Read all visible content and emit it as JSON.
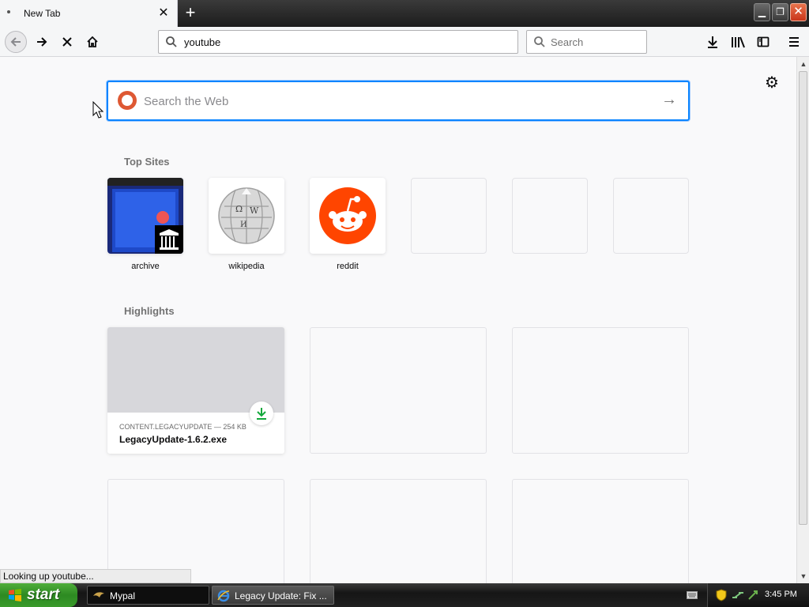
{
  "browser": {
    "tab": {
      "title": "New Tab",
      "close_glyph": "✕"
    },
    "newtab_glyph": "+",
    "window_controls": {
      "minimize": "▁",
      "restore": "❐",
      "close": "✕"
    },
    "url": "youtube",
    "search_placeholder": "Search"
  },
  "newtab": {
    "web_search_placeholder": "Search the Web",
    "top_sites_title": "Top Sites",
    "top_sites": [
      {
        "label": "archive"
      },
      {
        "label": "wikipedia"
      },
      {
        "label": "reddit"
      }
    ],
    "highlights_title": "Highlights",
    "highlight": {
      "source": "CONTENT.LEGACYUPDATE — 254 KB",
      "title": "LegacyUpdate-1.6.2.exe"
    }
  },
  "status_text": "Looking up youtube...",
  "taskbar": {
    "start_label": "start",
    "items": [
      {
        "label": "Mypal"
      },
      {
        "label": "Legacy Update: Fix ..."
      }
    ],
    "clock": "3:45 PM"
  },
  "colors": {
    "accent": "#0a84ff",
    "reddit": "#ff4500",
    "duckduckgo": "#de5833",
    "download_green": "#12a83b"
  }
}
